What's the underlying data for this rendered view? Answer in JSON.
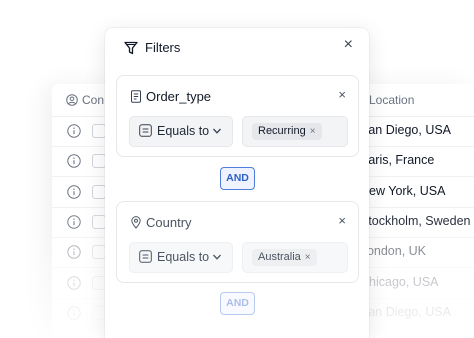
{
  "table": {
    "header": {
      "contact_label": "Con",
      "location_label": "Location"
    },
    "rows": [
      {
        "location": "San Diego, USA"
      },
      {
        "location": "Paris, France"
      },
      {
        "location": "New York, USA"
      },
      {
        "location": "Stockholm, Sweden"
      },
      {
        "location": "London, UK"
      },
      {
        "location": "Chicago, USA"
      },
      {
        "location": "San Diego, USA"
      }
    ]
  },
  "filters": {
    "title": "Filters",
    "close": "×",
    "conditions": [
      {
        "field": "Order_type",
        "field_icon": "document-icon",
        "operator": "Equals to",
        "value_chip": "Recurring",
        "remove": "×"
      },
      {
        "field": "Country",
        "field_icon": "location-pin-icon",
        "operator": "Equals to",
        "value_chip": "Australia",
        "remove": "×"
      }
    ],
    "connector": "AND",
    "chip_remove": "×"
  },
  "colors": {
    "accent": "#2f5fc9",
    "accent_bg": "#eef3ff"
  }
}
